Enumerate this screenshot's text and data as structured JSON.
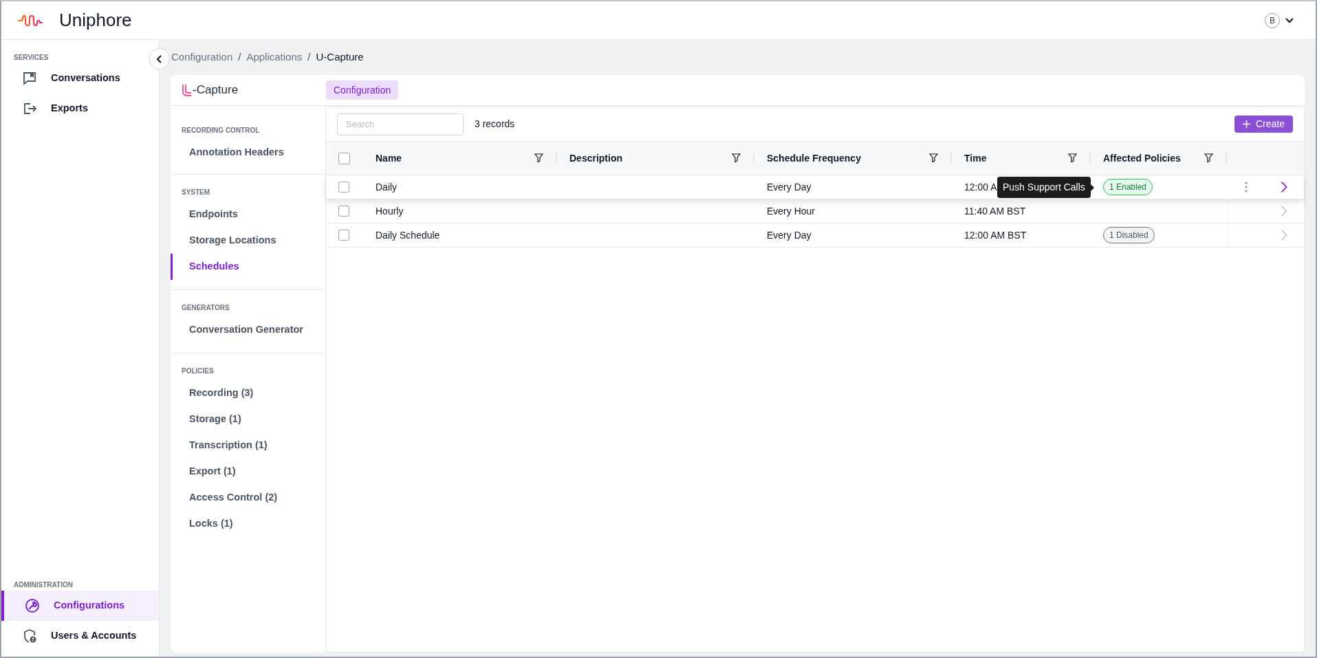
{
  "app": {
    "title": "Uniphore",
    "avatar": "B"
  },
  "sidebar": {
    "sections": [
      {
        "heading": "SERVICES",
        "items": [
          {
            "label": "Conversations",
            "selected": false
          },
          {
            "label": "Exports",
            "selected": false
          }
        ]
      },
      {
        "heading": "ADMINISTRATION",
        "items": [
          {
            "label": "Configurations",
            "selected": true
          },
          {
            "label": "Users & Accounts",
            "selected": false
          }
        ]
      }
    ]
  },
  "breadcrumb": {
    "separator": "/",
    "items": [
      "Configuration",
      "Applications",
      "U-Capture"
    ]
  },
  "card": {
    "logo_text": "-Capture",
    "tabs": [
      {
        "label": "Configuration",
        "selected": true
      }
    ]
  },
  "config_nav": [
    {
      "heading": "RECORDING CONTROL",
      "items": [
        {
          "label": "Annotation Headers",
          "selected": false
        }
      ]
    },
    {
      "heading": "SYSTEM",
      "items": [
        {
          "label": "Endpoints",
          "selected": false
        },
        {
          "label": "Storage Locations",
          "selected": false
        },
        {
          "label": "Schedules",
          "selected": true
        }
      ]
    },
    {
      "heading": "GENERATORS",
      "items": [
        {
          "label": "Conversation Generator",
          "selected": false
        }
      ]
    },
    {
      "heading": "POLICIES",
      "items": [
        {
          "label": "Recording (3)",
          "selected": false
        },
        {
          "label": "Storage (1)",
          "selected": false
        },
        {
          "label": "Transcription (1)",
          "selected": false
        },
        {
          "label": "Export (1)",
          "selected": false
        },
        {
          "label": "Access Control (2)",
          "selected": false
        },
        {
          "label": "Locks (1)",
          "selected": false
        }
      ]
    }
  ],
  "toolbar": {
    "search_placeholder": "Search",
    "record_count": "3 records",
    "create_button": "Create"
  },
  "table": {
    "all_checked": false,
    "columns": [
      "Name",
      "Description",
      "Schedule Frequency",
      "Time",
      "Affected Policies"
    ],
    "rows": [
      {
        "name": "Daily",
        "frequency": "Every Day",
        "time": "12:00 A",
        "policy": {
          "label": "1 Enabled",
          "kind": "enabled"
        },
        "hovered": true,
        "checked": false,
        "tooltip": "Push Support Calls"
      },
      {
        "name": "Hourly",
        "frequency": "Every Hour",
        "time": "11:40 AM BST",
        "hovered": false,
        "checked": false
      },
      {
        "name": "Daily Schedule",
        "frequency": "Every Day",
        "time": "12:00 AM BST",
        "policy": {
          "label": "1 Disabled",
          "kind": "disabled"
        },
        "hovered": false,
        "checked": false
      }
    ]
  }
}
